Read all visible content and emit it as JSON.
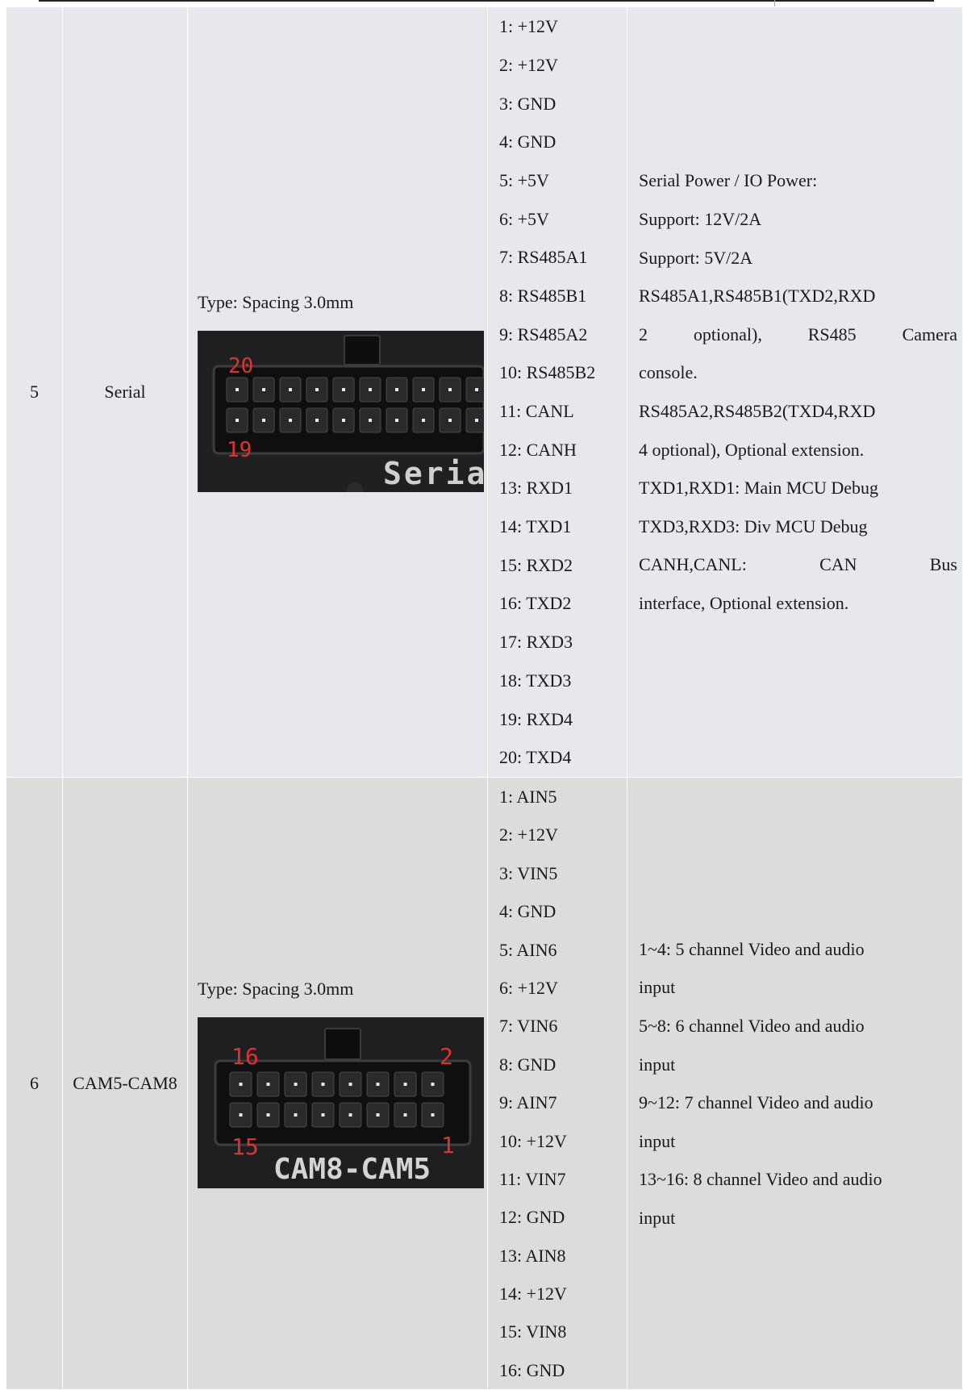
{
  "rows": [
    {
      "no": "5",
      "name": "Serial",
      "type": "Type: Spacing 3.0mm",
      "image": {
        "top_left": "20",
        "bottom_left": "19",
        "label": "Serial"
      },
      "pins": [
        "1: +12V",
        "2: +12V",
        "3: GND",
        "4: GND",
        "5: +5V",
        "6: +5V",
        "7: RS485A1",
        "8: RS485B1",
        "9: RS485A2",
        "10: RS485B2",
        "11: CANL",
        "12: CANH",
        "13: RXD1",
        "14: TXD1",
        "15: RXD2",
        "16: TXD2",
        "17: RXD3",
        "18: TXD3",
        "19: RXD4",
        "20: TXD4"
      ],
      "desc": [
        "Serial Power / IO Power:",
        "Support: 12V/2A",
        "Support: 5V/2A",
        "RS485A1,RS485B1(TXD2,RXD",
        "2 optional), RS485 Camera",
        "console.",
        "RS485A2,RS485B2(TXD4,RXD",
        "4 optional), Optional extension.",
        "TXD1,RXD1: Main MCU Debug",
        "TXD3,RXD3: Div MCU Debug",
        "CANH,CANL: CAN Bus",
        "interface, Optional extension."
      ]
    },
    {
      "no": "6",
      "name": "CAM5-CAM8",
      "type": "Type: Spacing 3.0mm",
      "image": {
        "top_left": "16",
        "top_right": "2",
        "bottom_left": "15",
        "bottom_right": "1",
        "label": "CAM8-CAM5"
      },
      "pins": [
        "1: AIN5",
        "2: +12V",
        "3: VIN5",
        "4: GND",
        "5: AIN6",
        "6: +12V",
        "7: VIN6",
        "8: GND",
        "9: AIN7",
        "10: +12V",
        "11: VIN7",
        "12: GND",
        "13: AIN8",
        "14: +12V",
        "15: VIN8",
        "16: GND"
      ],
      "desc": [
        "1~4: 5 channel Video and audio",
        "input",
        "5~8: 6 channel Video and audio",
        "input",
        "9~12: 7 channel Video and audio",
        "input",
        "13~16: 8 channel Video and audio",
        "input"
      ]
    }
  ]
}
